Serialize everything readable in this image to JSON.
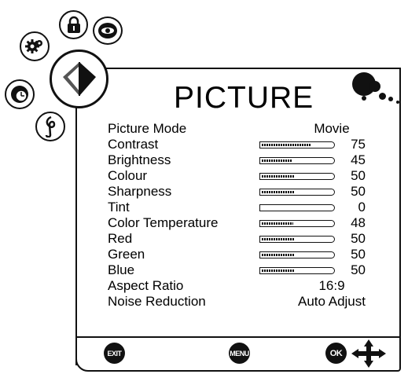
{
  "menu": {
    "title": "PICTURE",
    "rows": [
      {
        "label": "Picture Mode",
        "kind": "text",
        "value": "Movie"
      },
      {
        "label": "Contrast",
        "kind": "slider",
        "value": "75",
        "level": 75
      },
      {
        "label": "Brightness",
        "kind": "slider",
        "value": "45",
        "level": 45
      },
      {
        "label": "Colour",
        "kind": "slider",
        "value": "50",
        "level": 50
      },
      {
        "label": "Sharpness",
        "kind": "slider",
        "value": "50",
        "level": 50
      },
      {
        "label": "Tint",
        "kind": "slider",
        "value": "0",
        "level": 0
      },
      {
        "label": "Color Temperature",
        "kind": "slider",
        "value": "48",
        "level": 48
      },
      {
        "label": "Red",
        "kind": "slider",
        "value": "50",
        "level": 50
      },
      {
        "label": "Green",
        "kind": "slider",
        "value": "50",
        "level": 50
      },
      {
        "label": "Blue",
        "kind": "slider",
        "value": "50",
        "level": 50
      },
      {
        "label": "Aspect Ratio",
        "kind": "text",
        "value": "16:9"
      },
      {
        "label": "Noise Reduction",
        "kind": "text",
        "value": "Auto Adjust"
      }
    ]
  },
  "categories": [
    {
      "name": "lock-icon"
    },
    {
      "name": "gear-icon"
    },
    {
      "name": "picture-icon",
      "active": true
    },
    {
      "name": "eye-icon"
    },
    {
      "name": "clock-icon"
    },
    {
      "name": "music-icon"
    }
  ],
  "footer": {
    "exit_label": "EXIT",
    "menu_label": "MENU",
    "ok_label": "OK",
    "nav_icon": "arrows-icon"
  }
}
